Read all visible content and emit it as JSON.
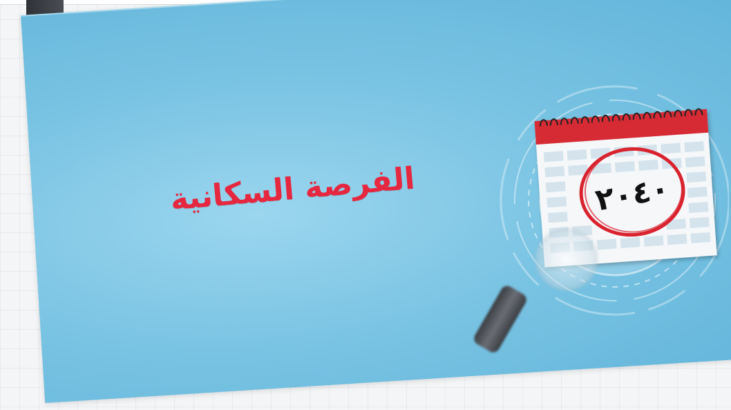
{
  "scene": {
    "title": "الفرصة السكانية",
    "calendar_year": "٢٠٤٠",
    "title_color": "#e5283f",
    "background_color": "#79c3e3",
    "calendar_header_color": "#d62b35"
  },
  "icons": {
    "calendar": "calendar-icon",
    "magnifier": "magnifying-glass-icon"
  }
}
